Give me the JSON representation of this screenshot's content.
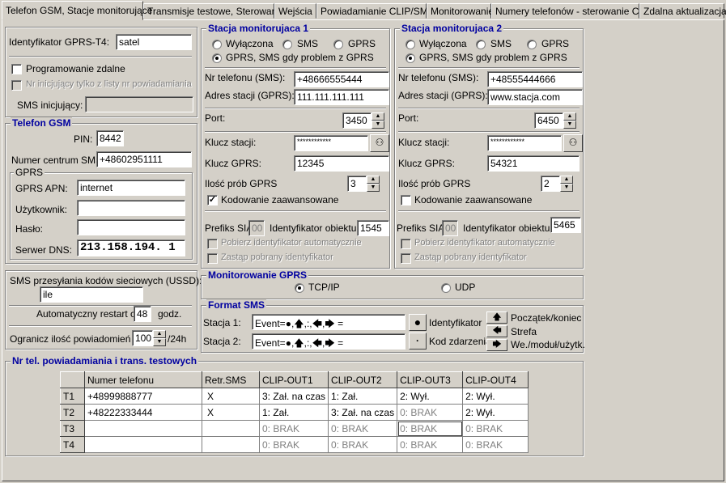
{
  "tabs": [
    "Telefon GSM, Stacje monitorujące",
    "Transmisje testowe, Sterowanie",
    "Wejścia",
    "Powiadamianie CLIP/SMS",
    "Monitorowanie",
    "Numery telefonów - sterowanie CLIP",
    "Zdalna aktualizacja"
  ],
  "left": {
    "gprs_id_label": "Identyfikator GPRS-T4:",
    "gprs_id_value": "satel",
    "remote_prog_label": "Programowanie zdalne",
    "init_only_label": "Nr inicjujący tylko z listy nr powiadamiania",
    "sms_init_label": "SMS inicjujący:",
    "sms_init_value": "",
    "gsm_title": "Telefon GSM",
    "pin_label": "PIN:",
    "pin_value": "8442",
    "sms_center_label": "Numer centrum SMS:",
    "sms_center_value": "+48602951111",
    "gprs_title": "GPRS",
    "apn_label": "GPRS APN:",
    "apn_value": "internet",
    "user_label": "Użytkownik:",
    "user_value": "",
    "pass_label": "Hasło:",
    "pass_value": "",
    "dns_label": "Serwer DNS:",
    "dns_value": "213.158.194.  1",
    "ussd_label": "SMS przesyłania kodów sieciowych (USSD):",
    "ussd_value": "ile",
    "restart_label": "Automatyczny restart co:",
    "restart_value": "48",
    "restart_unit": "godz.",
    "limit_label": "Ogranicz ilość powiadomień do:",
    "limit_value": "100",
    "limit_unit": "/24h"
  },
  "station1": {
    "title": "Stacja monitorujaca 1",
    "opt_off": "Wyłączona",
    "opt_sms": "SMS",
    "opt_gprs": "GPRS",
    "opt_both": "GPRS, SMS gdy problem z GPRS",
    "phone_label": "Nr telefonu (SMS):",
    "phone_value": "+48666555444",
    "addr_label": "Adres stacji (GPRS):",
    "addr_value": "111.111.111.111",
    "port_label": "Port:",
    "port_value": "3450",
    "key_label": "Klucz stacji:",
    "key_value": "************",
    "gprs_key_label": "Klucz GPRS:",
    "gprs_key_value": "12345",
    "tries_label": "Ilość prób GPRS",
    "tries_value": "3",
    "adv_label": "Kodowanie zaawansowane",
    "sia_label": "Prefiks SIA:",
    "sia_value": "00",
    "obj_label": "Identyfikator  obiektu:",
    "obj_value": "1545",
    "auto_label": "Pobierz identyfikator automatycznie",
    "replace_label": "Zastąp pobrany identyfikator"
  },
  "station2": {
    "title": "Stacja monitorujaca 2",
    "opt_off": "Wyłączona",
    "opt_sms": "SMS",
    "opt_gprs": "GPRS",
    "opt_both": "GPRS, SMS gdy problem z GPRS",
    "phone_label": "Nr telefonu (SMS):",
    "phone_value": "+48555444666",
    "addr_label": "Adres stacji (GPRS):",
    "addr_value": "www.stacja.com",
    "port_label": "Port:",
    "port_value": "6450",
    "key_label": "Klucz stacji:",
    "key_value": "************",
    "gprs_key_label": "Klucz GPRS:",
    "gprs_key_value": "54321",
    "tries_label": "Ilość prób GPRS",
    "tries_value": "2",
    "adv_label": "Kodowanie zaawansowane",
    "sia_label": "Prefiks SIA:",
    "sia_value": "00",
    "obj_label": "Identyfikator  obiektu:",
    "obj_value": "5465",
    "auto_label": "Pobierz identyfikator automatycznie",
    "replace_label": "Zastąp pobrany identyfikator"
  },
  "gprs_mon": {
    "title": "Monitorowanie GPRS",
    "tcp": "TCP/IP",
    "udp": "UDP"
  },
  "sms_format": {
    "title": "Format SMS",
    "st1_label": "Stacja 1:",
    "st1_value": "Event=●,🡅,:,🡄,🡆 =",
    "st2_label": "Stacja 2:",
    "st2_value": "Event=●,🡅,:,🡄,🡆 =",
    "btn_id": "●",
    "id_label": "Identyfikator",
    "btn_code": "·",
    "code_label": "Kod zdarzenia",
    "up_label": "Początek/koniec",
    "left_label": "Strefa",
    "right_label": "We./moduł/użytk."
  },
  "numbers": {
    "title": "Nr tel. powiadamiania i trans. testowych",
    "headers": [
      "",
      "Numer telefonu",
      "Retr.SMS",
      "CLIP-OUT1",
      "CLIP-OUT2",
      "CLIP-OUT3",
      "CLIP-OUT4"
    ],
    "rows": [
      [
        "T1",
        "+48999888777",
        "X",
        "3: Zał. na czas",
        "1: Zał.",
        "2: Wył.",
        "2: Wył."
      ],
      [
        "T2",
        "+48222333444",
        "X",
        "1: Zał.",
        "3: Zał. na czas",
        "0: BRAK",
        "2: Wył."
      ],
      [
        "T3",
        "",
        "",
        "0: BRAK",
        "0: BRAK",
        "0: BRAK",
        "0: BRAK"
      ],
      [
        "T4",
        "",
        "",
        "0: BRAK",
        "0: BRAK",
        "0: BRAK",
        "0: BRAK"
      ]
    ]
  }
}
